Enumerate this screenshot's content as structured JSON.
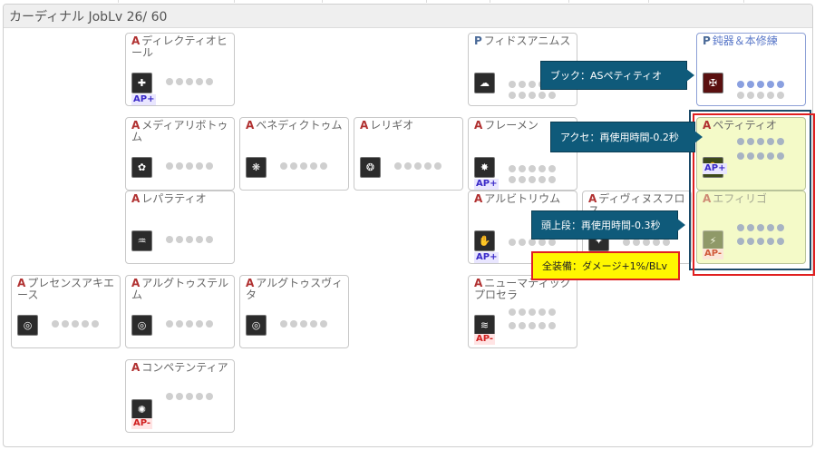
{
  "header": {
    "title": "カーディナル JobLv 26/ 60"
  },
  "skills": {
    "directio": {
      "badge": "A",
      "name": "ディレクティオヒール",
      "ap": "AP+",
      "icon": "✚"
    },
    "mediario": {
      "badge": "A",
      "name": "メディアリボトゥム",
      "icon": "✿"
    },
    "benedict": {
      "badge": "A",
      "name": "ベネディクトゥム",
      "icon": "❋"
    },
    "religio": {
      "badge": "A",
      "name": "レリギオ",
      "icon": "❂"
    },
    "fidus": {
      "badge": "P",
      "name": "フィドスアニムス",
      "icon": "☁"
    },
    "dulls": {
      "badge": "P",
      "name": "鈍器＆本修練",
      "icon": "✠"
    },
    "framen": {
      "badge": "A",
      "name": "フレーメン",
      "ap": "AP+",
      "icon": "✸"
    },
    "petitio": {
      "badge": "A",
      "name": "ペティティオ",
      "ap": "AP+",
      "icon": "✋"
    },
    "effligo": {
      "badge": "A",
      "name": "エフィリゴ",
      "ap": "AP-",
      "icon": "⚡"
    },
    "lebra": {
      "badge": "A",
      "name": "レパラティオ",
      "icon": "♒"
    },
    "arbitrium": {
      "badge": "A",
      "name": "アルビトリウム",
      "ap": "AP+",
      "icon": "✋"
    },
    "divinus": {
      "badge": "A",
      "name": "ディヴィヌスフロス",
      "icon": "✦"
    },
    "presens": {
      "badge": "A",
      "name": "プレセンスアキエース",
      "icon": "◎"
    },
    "argutus_t": {
      "badge": "A",
      "name": "アルグトゥステルム",
      "icon": "◎"
    },
    "argutus_v": {
      "badge": "A",
      "name": "アルグトゥスヴィタ",
      "icon": "◎"
    },
    "neuma": {
      "badge": "A",
      "name": "ニューマティックプロセラ",
      "ap": "AP-",
      "icon": "≋"
    },
    "competentia": {
      "badge": "A",
      "name": "コンペテンティア",
      "ap": "AP-",
      "icon": "✺"
    }
  },
  "callouts": {
    "book": "ブック：ASペティティオ",
    "accessory": "アクセ：再使用時間-0.2秒",
    "headgear": "頭上段：再使用時間-0.3秒",
    "all_equip": "全装備：ダメージ+1%/BLv"
  },
  "colors": {
    "ap_plus": "#3a2ac8",
    "ap_minus": "#d02020",
    "callout_bg": "#0f5a7a",
    "highlight_box": "#e02020",
    "highlight_card": "#f4fac8"
  }
}
